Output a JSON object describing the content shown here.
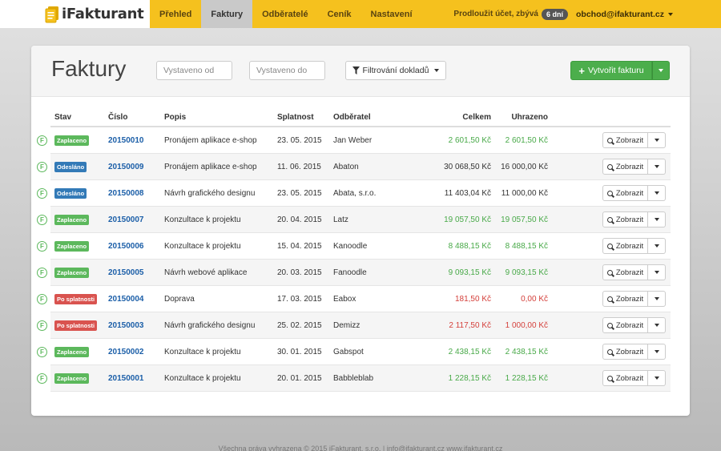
{
  "brand": {
    "name": "iFakturant"
  },
  "nav": {
    "items": [
      {
        "label": "Přehled",
        "active": false
      },
      {
        "label": "Faktury",
        "active": true
      },
      {
        "label": "Odběratelé",
        "active": false
      },
      {
        "label": "Ceník",
        "active": false
      },
      {
        "label": "Nastavení",
        "active": false
      }
    ],
    "extend_text": "Prodloužit účet, zbývá",
    "days_left": "6 dní",
    "account_email": "obchod@ifakturant.cz"
  },
  "page": {
    "title": "Faktury",
    "issued_from_placeholder": "Vystaveno od",
    "issued_to_placeholder": "Vystaveno do",
    "filter_label": "Filtrování dokladů",
    "create_label": "Vytvořit fakturu"
  },
  "table": {
    "headers": {
      "stav": "Stav",
      "cislo": "Číslo",
      "popis": "Popis",
      "splatnost": "Splatnost",
      "odberatel": "Odběratel",
      "celkem": "Celkem",
      "uhrazeno": "Uhrazeno"
    },
    "view_label": "Zobrazit",
    "rows": [
      {
        "status": "Zaplaceno",
        "number": "20150010",
        "desc": "Pronájem aplikace e-shop",
        "due": "23. 05. 2015",
        "client": "Jan Weber",
        "total": "2 601,50 Kč",
        "paid": "2 601,50 Kč"
      },
      {
        "status": "Odesláno",
        "number": "20150009",
        "desc": "Pronájem aplikace e-shop",
        "due": "11. 06. 2015",
        "client": "Abaton",
        "total": "30 068,50 Kč",
        "paid": "16 000,00 Kč"
      },
      {
        "status": "Odesláno",
        "number": "20150008",
        "desc": "Návrh grafického designu",
        "due": "23. 05. 2015",
        "client": "Abata, s.r.o.",
        "total": "11 403,04 Kč",
        "paid": "11 000,00 Kč"
      },
      {
        "status": "Zaplaceno",
        "number": "20150007",
        "desc": "Konzultace k projektu",
        "due": "20. 04. 2015",
        "client": "Latz",
        "total": "19 057,50 Kč",
        "paid": "19 057,50 Kč"
      },
      {
        "status": "Zaplaceno",
        "number": "20150006",
        "desc": "Konzultace k projektu",
        "due": "15. 04. 2015",
        "client": "Kanoodle",
        "total": "8 488,15 Kč",
        "paid": "8 488,15 Kč"
      },
      {
        "status": "Zaplaceno",
        "number": "20150005",
        "desc": "Návrh webové aplikace",
        "due": "20. 03. 2015",
        "client": "Fanoodle",
        "total": "9 093,15 Kč",
        "paid": "9 093,15 Kč"
      },
      {
        "status": "Po splatnosti",
        "number": "20150004",
        "desc": "Doprava",
        "due": "17. 03. 2015",
        "client": "Eabox",
        "total": "181,50 Kč",
        "paid": "0,00 Kč"
      },
      {
        "status": "Po splatnosti",
        "number": "20150003",
        "desc": "Návrh grafického designu",
        "due": "25. 02. 2015",
        "client": "Demizz",
        "total": "2 117,50 Kč",
        "paid": "1 000,00 Kč"
      },
      {
        "status": "Zaplaceno",
        "number": "20150002",
        "desc": "Konzultace k projektu",
        "due": "30. 01. 2015",
        "client": "Gabspot",
        "total": "2 438,15 Kč",
        "paid": "2 438,15 Kč"
      },
      {
        "status": "Zaplaceno",
        "number": "20150001",
        "desc": "Konzultace k projektu",
        "due": "20. 01. 2015",
        "client": "Babbleblab",
        "total": "1 228,15 Kč",
        "paid": "1 228,15 Kč"
      }
    ]
  },
  "status_colors": {
    "Zaplaceno": "#5cb85c",
    "Odesláno": "#337ab7",
    "Po splatnosti": "#d9534f"
  },
  "amount_colors": {
    "Zaplaceno": "green",
    "Odesláno": "plain",
    "Po splatnosti": "red"
  },
  "footer": {
    "text": "Všechna práva vyhrazena © 2015   iFakturant, s.r.o.   |   info@ifakturant.cz   www.ifakturant.cz"
  }
}
